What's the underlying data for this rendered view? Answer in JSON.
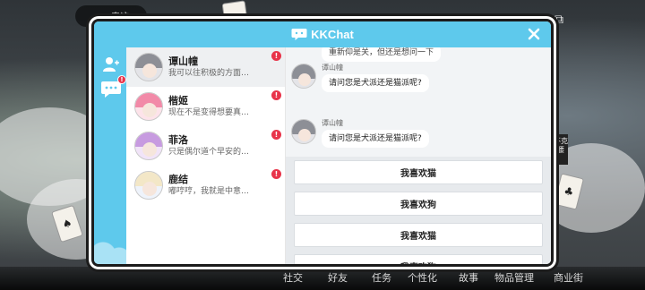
{
  "window": {
    "title": "KKChat"
  },
  "rail": {
    "contacts_icon": "contacts-icon",
    "messages_icon": "chat-bubble-icon"
  },
  "contacts": [
    {
      "name": "谭山幢",
      "preview": "我可以往积极的方面…",
      "unread": "!",
      "hair": "#8d8f96"
    },
    {
      "name": "楷姬",
      "preview": "现在不是变得想要真…",
      "unread": "!",
      "hair": "#f28aa8"
    },
    {
      "name": "菲洛",
      "preview": "只是偶尔道个早安的…",
      "unread": "!",
      "hair": "#c79be0"
    },
    {
      "name": "鹿结",
      "preview": "嘟哼哼，我就是中意…",
      "unread": "!",
      "hair": "#f3e7c7"
    }
  ],
  "messages": [
    {
      "sender": "谭山幢",
      "text": "请问您是犬派还是猫派呢?"
    },
    {
      "sender": "谭山幢",
      "text": "请问您是犬派还是猫派呢?"
    }
  ],
  "partial_top_message": "重新仰是关，但还是想问一下",
  "reply_options": [
    "我喜欢猫",
    "我喜欢狗",
    "我喜欢猫",
    "我喜欢狗"
  ],
  "background_nav": [
    "社交",
    "好友",
    "任务",
    "个性化",
    "故事",
    "物品管理",
    "商业街"
  ],
  "background_misc": {
    "chip_label": "奇迹",
    "side_tag": "不克腰"
  },
  "colors": {
    "accent": "#5ec9ec",
    "badge": "#e8344a"
  }
}
